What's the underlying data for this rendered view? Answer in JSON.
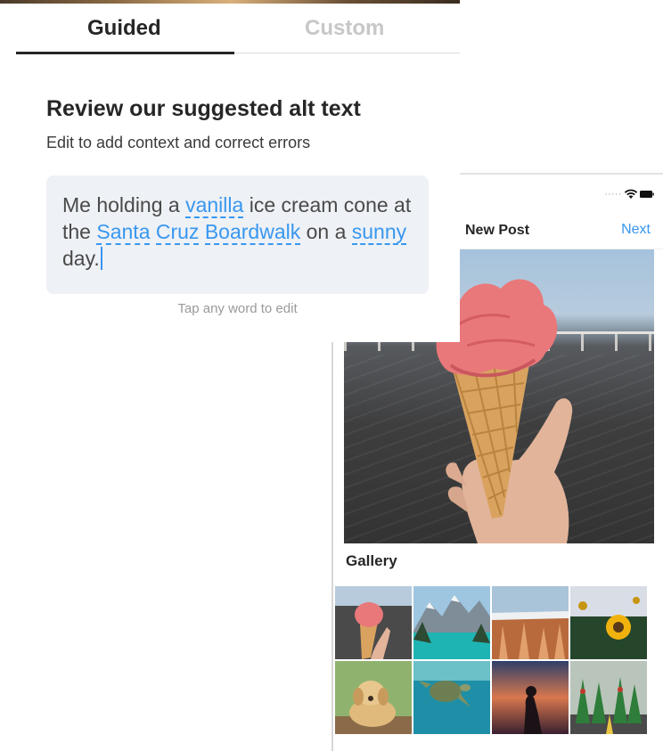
{
  "tabs": {
    "guided": "Guided",
    "custom": "Custom",
    "active": "guided"
  },
  "alt_text": {
    "heading": "Review our suggested alt text",
    "subheading": "Edit to add context and correct errors",
    "text": {
      "p1": "Me holding a ",
      "w1": "vanilla",
      "p2": " ice cream cone at the ",
      "w2": "Santa",
      "p3": " ",
      "w3": "Cruz",
      "p4": " ",
      "w4": "Boardwalk",
      "p5": " on a ",
      "w5": "sunny",
      "p6": " day."
    },
    "hint": "Tap any word to edit"
  },
  "new_post": {
    "title": "New Post",
    "next": "Next",
    "gallery_label": "Gallery",
    "gallery_items": [
      "ice-cream",
      "mountain-lake",
      "canyon-hoodoos",
      "sunflower",
      "puppy",
      "sea-turtle",
      "sunset-silhouette",
      "parade-costumes"
    ]
  },
  "colors": {
    "accent": "#3897f0",
    "text": "#262626",
    "muted": "#c7c7c7",
    "box": "#eef1f5"
  }
}
